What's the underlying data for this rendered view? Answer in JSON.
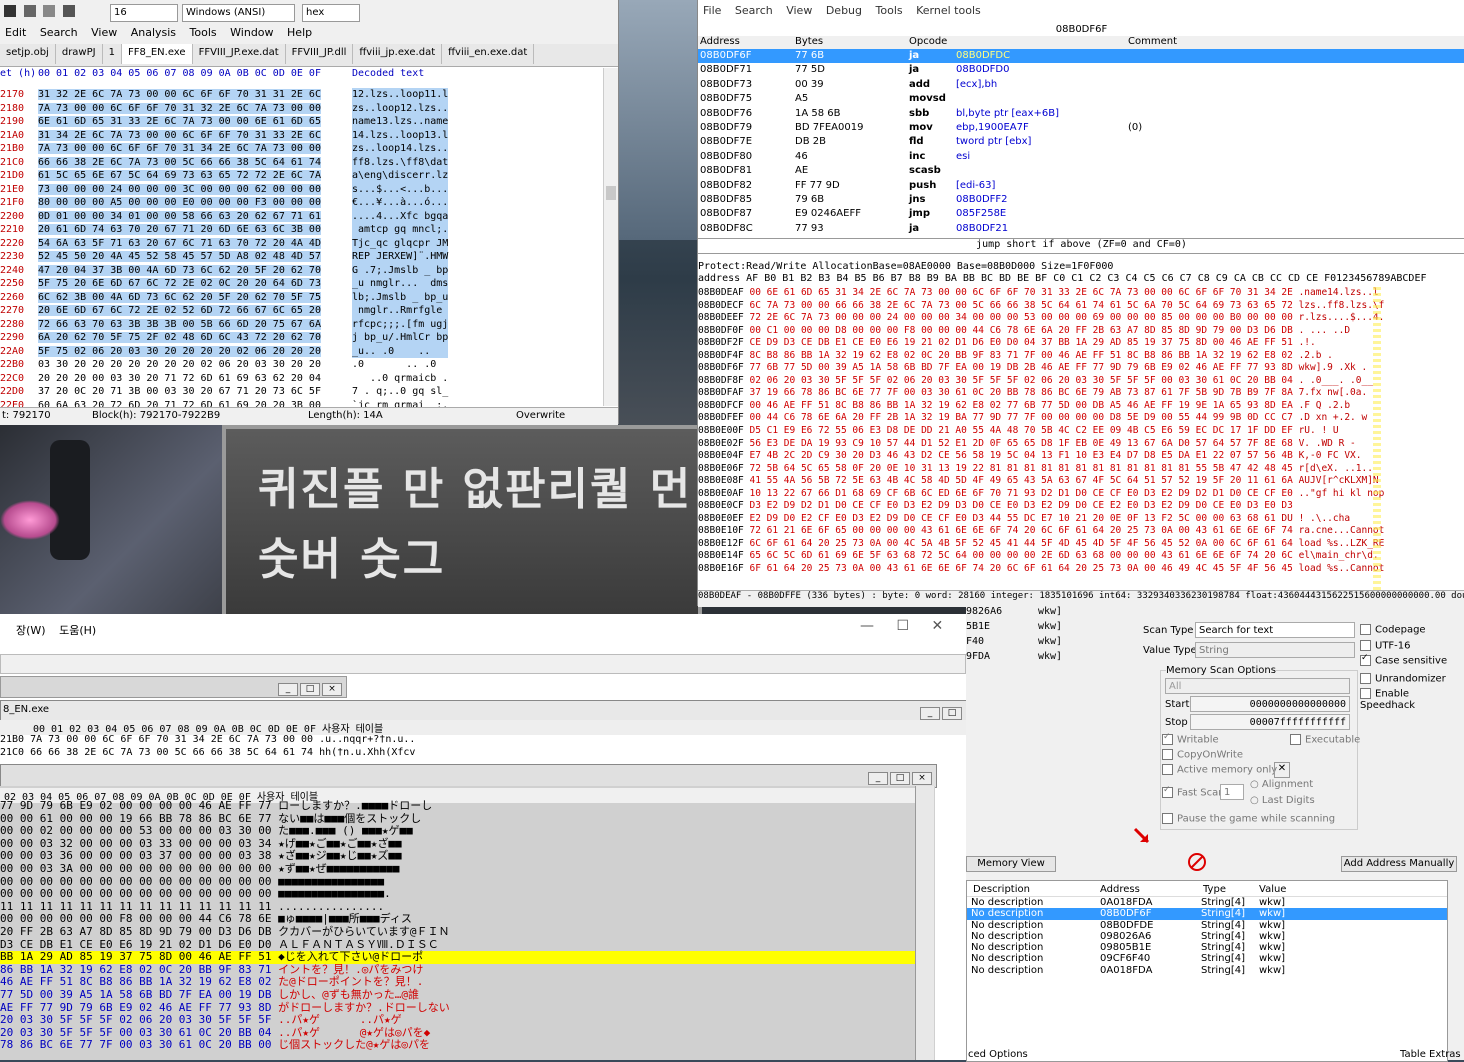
{
  "dialog": {
    "line1": "퀴진플 만 없판리퀄 먼",
    "line2": "숫버 숫그"
  },
  "hex_editor": {
    "toolbar": {
      "font_size": "16",
      "encoding": "Windows (ANSI)",
      "mode": "hex"
    },
    "menu": [
      "Edit",
      "Search",
      "View",
      "Analysis",
      "Tools",
      "Window",
      "Help"
    ],
    "tabs": [
      "setjp.obj",
      "drawPJ",
      "1",
      "FF8_EN.exe",
      "FFVIII_JP.exe.dat",
      "FFVIII_JP.dll",
      "ffviii_jp.exe.dat",
      "ffviii_en.exe.dat"
    ],
    "header_offset": "et (h)",
    "header_cols": "00 01 02 03 04 05 06 07 08 09 0A 0B 0C 0D 0E 0F",
    "header_decoded": "Decoded text",
    "rows": [
      {
        "off": "2170",
        "hex": "31 32 2E 6C 7A 73 00 00 6C 6F 6F 70 31 31 2E 6C",
        "txt": "12.lzs..loop11.l"
      },
      {
        "off": "2180",
        "hex": "7A 73 00 00 6C 6F 6F 70 31 32 2E 6C 7A 73 00 00",
        "txt": "zs..loop12.lzs.."
      },
      {
        "off": "2190",
        "hex": "6E 61 6D 65 31 33 2E 6C 7A 73 00 00 6E 61 6D 65",
        "txt": "name13.lzs..name"
      },
      {
        "off": "21A0",
        "hex": "31 34 2E 6C 7A 73 00 00 6C 6F 6F 70 31 33 2E 6C",
        "txt": "14.lzs..loop13.l"
      },
      {
        "off": "21B0",
        "hex": "7A 73 00 00 6C 6F 6F 70 31 34 2E 6C 7A 73 00 00",
        "txt": "zs..loop14.lzs.."
      },
      {
        "off": "21C0",
        "hex": "66 66 38 2E 6C 7A 73 00 5C 66 66 38 5C 64 61 74",
        "txt": "ff8.lzs.\\ff8\\dat"
      },
      {
        "off": "21D0",
        "hex": "61 5C 65 6E 67 5C 64 69 73 63 65 72 72 2E 6C 7A",
        "txt": "a\\eng\\discerr.lz"
      },
      {
        "off": "21E0",
        "hex": "73 00 00 00 24 00 00 00 3C 00 00 00 62 00 00 00",
        "txt": "s...$...<...b..."
      },
      {
        "off": "21F0",
        "hex": "80 00 00 00 A5 00 00 00 E0 00 00 00 F3 00 00 00",
        "txt": "€...¥...à...ó..."
      },
      {
        "off": "2200",
        "hex": "0D 01 00 00 34 01 00 00 58 66 63 20 62 67 71 61",
        "txt": "....4...Xfc bgqa"
      },
      {
        "off": "2210",
        "hex": "20 61 6D 74 63 70 20 67 71 20 6D 6E 63 6C 3B 00",
        "txt": " amtcp gq mncl;."
      },
      {
        "off": "2220",
        "hex": "54 6A 63 5F 71 63 20 67 6C 71 63 70 72 20 4A 4D",
        "txt": "Tjc_qc glqcpr JM"
      },
      {
        "off": "2230",
        "hex": "52 45 50 20 4A 45 52 58 45 57 5D A8 02 48 4D 57",
        "txt": "REP JERXEW]¨.HMW"
      },
      {
        "off": "2240",
        "hex": "47 20 04 37 3B 00 4A 6D 73 6C 62 20 5F 20 62 70",
        "txt": "G .7;.Jmslb _ bp"
      },
      {
        "off": "2250",
        "hex": "5F 75 20 6E 6D 67 6C 72 2E 02 0C 20 20 64 6D 73",
        "txt": "_u nmglr...  dms"
      },
      {
        "off": "2260",
        "hex": "6C 62 3B 00 4A 6D 73 6C 62 20 5F 20 62 70 5F 75",
        "txt": "lb;.Jmslb _ bp_u"
      },
      {
        "off": "2270",
        "hex": "20 6E 6D 67 6C 72 2E 02 52 6D 72 66 67 6C 65 20",
        "txt": " nmglr..Rmrfgle "
      },
      {
        "off": "2280",
        "hex": "72 66 63 70 63 3B 3B 3B 00 5B 66 6D 20 75 67 6A",
        "txt": "rfcpc;;;.[fm ugj"
      },
      {
        "off": "2290",
        "hex": "6A 20 62 70 5F 75 2F 02 48 6D 6C 43 72 20 62 70",
        "txt": "j bp_u/.HmlCr bp"
      },
      {
        "off": "22A0",
        "hex": "5F 75 02 06 20 03 30 20 20 20 20 02 06 20 20 20",
        "txt": "_u.. .0    ..   "
      },
      {
        "off": "22B0",
        "hex": "03 30 20 20 20 20 20 20 20 02 06 20 03 30 20 20",
        "txt": ".0       .. .0  "
      },
      {
        "off": "22C0",
        "hex": "20 20 20 00 03 30 20 71 72 6D 61 69 63 62 20 04",
        "txt": "   ..0 qrmaicb ."
      },
      {
        "off": "22D0",
        "hex": "37 20 0C 20 71 3B 00 03 30 20 67 71 20 73 6C 5F",
        "txt": "7 . q;..0 gq sl_"
      },
      {
        "off": "22E0",
        "hex": "60 6A 63 20 72 6D 20 71 72 6D 61 69 20 20 3B 00",
        "txt": "`jc rm qrmai  ;."
      },
      {
        "off": "22F0",
        "hex": "00 4A 6D 73 6C 62 20 5F 20 62 70 5F 75 20 6E 6D",
        "txt": ".Jmslb _ bp_u nm"
      }
    ],
    "status": {
      "offset": "t: 792170",
      "block": "Block(h): 792170-7922B9",
      "length": "Length(h): 14A",
      "mode": "Overwrite"
    }
  },
  "debugger": {
    "menu": [
      "File",
      "Search",
      "View",
      "Debug",
      "Tools",
      "Kernel tools"
    ],
    "title": "08B0DF6F",
    "columns": [
      "Address",
      "Bytes",
      "Opcode",
      "Comment"
    ],
    "rows": [
      {
        "addr": "08B0DF6F",
        "bytes": "77 6B",
        "op": "ja",
        "arg": "08B0DFDC",
        "cmt": ""
      },
      {
        "addr": "08B0DF71",
        "bytes": "77 5D",
        "op": "ja",
        "arg": "08B0DFD0",
        "cmt": ""
      },
      {
        "addr": "08B0DF73",
        "bytes": "00 39",
        "op": "add",
        "arg": "[ecx],bh",
        "cmt": ""
      },
      {
        "addr": "08B0DF75",
        "bytes": "A5",
        "op": "movsd",
        "arg": "",
        "cmt": ""
      },
      {
        "addr": "08B0DF76",
        "bytes": "1A 58 6B",
        "op": "sbb",
        "arg": "bl,byte ptr [eax+6B]",
        "cmt": ""
      },
      {
        "addr": "08B0DF79",
        "bytes": "BD 7FEA0019",
        "op": "mov",
        "arg": "ebp,1900EA7F",
        "cmt": "(0)"
      },
      {
        "addr": "08B0DF7E",
        "bytes": "DB 2B",
        "op": "fld",
        "arg": "tword ptr [ebx]",
        "cmt": ""
      },
      {
        "addr": "08B0DF80",
        "bytes": "46",
        "op": "inc",
        "arg": "esi",
        "cmt": ""
      },
      {
        "addr": "08B0DF81",
        "bytes": "AE",
        "op": "scasb",
        "arg": "",
        "cmt": ""
      },
      {
        "addr": "08B0DF82",
        "bytes": "FF 77 9D",
        "op": "push",
        "arg": "[edi-63]",
        "cmt": ""
      },
      {
        "addr": "08B0DF85",
        "bytes": "79 6B",
        "op": "jns",
        "arg": "08B0DFF2",
        "cmt": ""
      },
      {
        "addr": "08B0DF87",
        "bytes": "E9 0246AEFF",
        "op": "jmp",
        "arg": "085F258E",
        "cmt": ""
      },
      {
        "addr": "08B0DF8C",
        "bytes": "77 93",
        "op": "ja",
        "arg": "08B0DF21",
        "cmt": ""
      }
    ],
    "jump_status": "jump short if above (ZF=0 and CF=0)",
    "mem_protect": "Protect:Read/Write  AllocationBase=08AE0000 Base=08B0D000 Size=1F0F000",
    "mem_header": "address  AF B0 B1 B2 B3 B4 B5 B6 B7 B8 B9 BA BB BC BD BE BF C0 C1 C2 C3 C4 C5 C6 C7 C8 C9 CA CB CC CD CE F0123456789ABCDEF",
    "mem_rows": [
      {
        "a": "08B0DEAF",
        "b": "00 6E 61 6D 65 31 34 2E 6C 7A 73 00 00 6C 6F 6F 70 31 33 2E 6C 7A 73 00 00 6C 6F 6F 70 31 34 2E",
        "t": ".name14.lzs..l"
      },
      {
        "a": "08B0DECF",
        "b": "6C 7A 73 00 00 66 66 38 2E 6C 7A 73 00 5C 66 66 38 5C 64 61 74 61 5C 6A 70 5C 64 69 73 63 65 72",
        "t": "lzs..ff8.lzs.\\f"
      },
      {
        "a": "08B0DEEF",
        "b": "72 2E 6C 7A 73 00 00 00 24 00 00 00 34 00 00 00 53 00 00 00 69 00 00 00 85 00 00 00 B0 00 00 00",
        "t": "r.lzs....$...4."
      },
      {
        "a": "08B0DF0F",
        "b": "00 C1 00 00 00 D8 00 00 00 F8 00 00 00 44 C6 78 6E 6A 20 FF 2B 63 A7 8D 85 8D 9D 79 00 D3 D6 DB",
        "t": ".  ...  ..D"
      },
      {
        "a": "08B0DF2F",
        "b": "CE D9 D3 CE DB E1 CE E0 E6 19 21 02 D1 D6 E0 D0 04 37 BB 1A 29 AD 85 19 37 75 8D 00 46 AE FF 51",
        "t": ".!."
      },
      {
        "a": "08B0DF4F",
        "b": "8C B8 86 BB 1A 32 19 62 E8 02 0C 20 BB 9F 83 71 7F 00 46 AE FF 51 8C B8 86 BB 1A 32 19 62 E8 02",
        "t": ".2.b ."
      },
      {
        "a": "08B0DF6F",
        "b": "77 6B 77 5D 00 39 A5 1A 58 6B BD 7F EA 00 19 DB 2B 46 AE FF 77 9D 79 6B E9 02 46 AE FF 77 93 8D",
        "t": "wkw].9 .Xk ."
      },
      {
        "a": "08B0DF8F",
        "b": "02 06 20 03 30 5F 5F 5F 02 06 20 03 30 5F 5F 5F 02 06 20 03 30 5F 5F 5F 00 03 30 61 0C 20 BB 04",
        "t": ". .0___. .0__"
      },
      {
        "a": "08B0DFAF",
        "b": "37 19 66 78 86 BC 6E 77 7F 00 03 30 61 0C 20 BB 78 86 BC 6E 79 AB 73 87 61 7F 5B 9D 7B B9 7F 8A",
        "t": "7.fx nw[.0a."
      },
      {
        "a": "08B0DFCF",
        "b": "00 46 AE FF 51 8C B8 86 BB 1A 32 19 62 E8 02 77 6B 77 5D 00 DB A5 46 AE FF 19 9E 1A 65 93 8D EA",
        "t": ".F Q   .2.b"
      },
      {
        "a": "08B0DFEF",
        "b": "00 44 C6 78 6E 6A 20 FF 2B 1A 32 19 BA 77 9D 77 7F 00 00 00 00 D8 5E D9 00 55 44 99 9B 0D CC C7",
        "t": ".D xn  +.2. w"
      },
      {
        "a": "08B0E00F",
        "b": "D5 C1 E9 E6 72 55 06 E3 D8 DE DD 21 A0 55 4A 48 70 5B 4C C2 EE 09 4B C5 E6 59 EC DC 17 1F DD EF",
        "t": "rU.  ! U"
      },
      {
        "a": "08B0E02F",
        "b": "56 E3 DE DA 19 93 C9 10 57 44 D1 52 E1 2D 0F 65 65 D8 1F EB 0E 49 13 67 6A D0 57 64 57 7F 8E 68",
        "t": "V.   .WD R -"
      },
      {
        "a": "08B0E04F",
        "b": "E7 4B 2C 2D C9 30 20 D3 46 43 D2 CE 56 58 19 5C 04 13 F1 10 E3 E4 D7 D8 E5 DA E1 22 07 57 56 4B",
        "t": "K,-0 FC VX."
      },
      {
        "a": "08B0E06F",
        "b": "72 5B 64 5C 65 58 0F 20 0E 10 31 13 19 22 81 81 81 81 81 81 81 81 81 81 81 81 55 5B 47 42 48 45",
        "t": "r[d\\eX. ..1.."
      },
      {
        "a": "08B0E08F",
        "b": "41 55 4A 56 5B 72 5E 63 4B 4C 58 4D 5D 4F 49 65 43 5A 63 67 4F 5C 64 51 57 52 19 5F 20 11 61 6A",
        "t": "AUJV[r^cKLXM]N"
      },
      {
        "a": "08B0E0AF",
        "b": "10 13 22 67 66 D1 68 69 CF 6B 6C ED 6E 6F 70 71 93 D2 D1 D0 CE CF E0 D3 E2 D9 D2 D1 D0 CE CF E0",
        "t": "..\"gf hi kl nop"
      },
      {
        "a": "08B0E0CF",
        "b": "D3 E2 D9 D2 D1 D0 CE CF E0 D3 E2 D9 D3 D0 CE E0 D3 E2 D9 D0 CE E2 E0 D3 E2 D9 D0 CE E0 D3 E0 D3",
        "t": ""
      },
      {
        "a": "08B0E0EF",
        "b": "E2 D9 D0 E2 CF E0 D3 E2 D9 D0 CE CF E0 D3 44 55 DC E7 10 21 20 0E 0F 13 F2 5C 00 00 63 68 61",
        "t": "DU  ! .\\..cha"
      },
      {
        "a": "08B0E10F",
        "b": "72 61 21 6E 6F 65 00 00 00 00 43 61 6E 6E 6F 74 20 6C 6F 61 64 20 25 73 0A 00 43 61 6E 6E 6F 74",
        "t": "ra.cne...Cannot"
      },
      {
        "a": "08B0E12F",
        "b": "6C 6F 61 64 20 25 73 0A 00 4C 5A 4B 5F 52 45 41 44 5F 4D 45 4D 5F 4F 56 45 52 0A 00 6C 6F 61 64",
        "t": "load %s..LZK_RE"
      },
      {
        "a": "08B0E14F",
        "b": "65 6C 5C 6D 61 69 6E 5F 63 68 72 5C 64 00 00 00 00 2E 6D 63 68 00 00 00 43 61 6E 6E 6F 74 20 6C",
        "t": "el\\main_chr\\d."
      },
      {
        "a": "08B0E16F",
        "b": "6F 61 64 20 25 73 0A 00 43 61 6E 6E 6F 74 20 6C 6F 61 64 20 25 73 0A 00 46 49 4C 45 5F 4F 56 45",
        "t": "load %s..Cannot"
      }
    ],
    "mem_status": "08B0DEAF - 08B0DFFE (336 bytes) : byte: 0 word: 28160 integer: 1835101696 int64: 3329340336230198784 float:4360444315622515600000000000.00 double: 0.00"
  },
  "jp_editor": {
    "menu": [
      "장(W)",
      "도움(H)"
    ],
    "sub1_title": "",
    "sub2_title": "8_EN.exe",
    "hdr2": "00 01 02 03 04 05 06 07 08 09 0A 0B 0C 0D 0E 0F 사용자 테이블",
    "rows2": [
      "21B0 7A 73 00 00 6C 6F 6F 70 31 34 2E 6C 7A 73 00 00 .u..nqqr+?†n.u..",
      "21C0 66 66 38 2E 6C 7A 73 00 5C 66 66 38 5C 64 61 74 hh(†n.u.Xhh(Xfcv"
    ],
    "hdr3": "02 03 04 05 06 07 08 09 0A 0B 0C 0D 0E 0F 사용자 테이블",
    "rows3": [
      {
        "h": "77 9D 79 6B E9 02 00 00 00 00 46 AE FF 77",
        "t": "ローしますか？.■■■■ドローし",
        "c": ""
      },
      {
        "h": "00 00 61 00 00 00 19 66 BB 78 86 BC 6E 77",
        "t": "ない■■は■■■個をストックし",
        "c": ""
      },
      {
        "h": "00 00 02 00 00 00 00 53 00 00 00 03 30 00",
        "t": "た■■■.■■■ () ■■■★ゲ■■",
        "c": ""
      },
      {
        "h": "00 00 03 32 00 00 00 03 33 00 00 00 03 34",
        "t": "★げ■■★ご■■★ご■■★ざ■■",
        "c": ""
      },
      {
        "h": "00 00 03 36 00 00 00 03 37 00 00 00 03 38",
        "t": "★ざ■■★ジ■■★じ■■★ズ■■",
        "c": ""
      },
      {
        "h": "00 00 03 3A 00 00 00 00 00 00 00 00 00 00",
        "t": "★ず■■★ぜ■■■■■■■■■■■",
        "c": ""
      },
      {
        "h": "00 00 00 00 00 00 00 00 00 00 00 00 00 00",
        "t": "■■■■■■■■■■■■■■■■",
        "c": ""
      },
      {
        "h": "00 00 00 00 00 00 00 00 00 00 00 00 00 00",
        "t": "■■■■■■■■■■■■■■■■.",
        "c": ""
      },
      {
        "h": "11 11 11 11 11 11 11 11 11 11 11 11 11 11",
        "t": "................",
        "c": ""
      },
      {
        "h": "00 00 00 00 00 00 F8 00 00 00 44 C6 78 6E",
        "t": "■ゅ■■■■|■■■所■■■ディス",
        "c": ""
      },
      {
        "h": "20 FF 2B 63 A7 8D 85 8D 9D 79 00 D3 D6 DB",
        "t": "クカバーがひらいています@ＦＩＮ",
        "c": ""
      },
      {
        "h": "D3 CE DB E1 CE E0 E6 19 21 02 D1 D6 E0 D0",
        "t": "ＡＬＦＡＮＴＡＳＹⅧ.ＤＩＳＣ",
        "c": ""
      },
      {
        "h": "BB 1A 29 AD 85 19 37 75 8D 00 46 AE FF 51",
        "t": "◆じを入れて下さい@ドローポ",
        "c": "y"
      },
      {
        "h": "86 BB 1A 32 19 62 E8 02 0C 20 BB 9F 83 71",
        "t": "イントを？見！.◎パをみつけ",
        "c": "red"
      },
      {
        "h": "46 AE FF 51 8C B8 86 BB 1A 32 19 62 E8 02",
        "t": "た@ドローポイントを？見！.",
        "c": "red"
      },
      {
        "h": "77 5D 00 39 A5 1A 58 6B BD 7F EA 00 19 DB",
        "t": "しかし、@ずも無かった…@誰",
        "c": "red"
      },
      {
        "h": "AE FF 77 9D 79 6B E9 02 46 AE FF 77 93 8D",
        "t": "がドローしますか？.ドローしない",
        "c": "red"
      },
      {
        "h": "20 03 30 5F 5F 5F 02 06 20 03 30 5F 5F 5F",
        "t": "..パ★ゲ      ..パ★ゲ",
        "c": "red"
      },
      {
        "h": "20 03 30 5F 5F 5F 00 03 30 61 0C 20 BB 04",
        "t": "..パ★ゲ      @★ゲは◎パを◆",
        "c": "red"
      },
      {
        "h": "78 86 BC 6E 77 7F 00 03 30 61 0C 20 BB 00",
        "t": "じ個ストックした@★ゲは◎パを",
        "c": "red"
      }
    ]
  },
  "cheat_engine": {
    "found_list": [
      {
        "addr": "9826A6",
        "val": "wkw]"
      },
      {
        "addr": "5B1E",
        "val": "wkw]"
      },
      {
        "addr": "F40",
        "val": "wkw]"
      },
      {
        "addr": "9FDA",
        "val": "wkw]"
      }
    ],
    "scan_type_label": "Scan Type",
    "scan_type_value": "Search for text",
    "value_type_label": "Value Type",
    "value_type_value": "String",
    "memory_scan_options": "Memory Scan Options",
    "region": "All",
    "start_label": "Start",
    "start_value": "0000000000000000",
    "stop_label": "Stop",
    "stop_value": "00007fffffffffff",
    "writable": "Writable",
    "executable": "Executable",
    "copy_on_write": "CopyOnWrite",
    "active_memory_only": "Active memory only",
    "fast_scan": "Fast Scan",
    "fast_scan_value": "1",
    "alignment": "Alignment",
    "last_digits": "Last Digits",
    "pause_game": "Pause the game while scanning",
    "codepage": "Codepage",
    "utf16": "UTF-16",
    "case_sensitive": "Case sensitive",
    "unrandomizer": "Unrandomizer",
    "enable_speedhack": "Enable Speedhack",
    "memory_view_button": "Memory View",
    "add_address_button": "Add Address Manually",
    "table_headers": [
      "Description",
      "Address",
      "Type",
      "Value"
    ],
    "table_rows": [
      {
        "desc": "No description",
        "addr": "0A018FDA",
        "type": "String[4]",
        "val": "wkw]"
      },
      {
        "desc": "No description",
        "addr": "08B0DF6F",
        "type": "String[4]",
        "val": "wkw]"
      },
      {
        "desc": "No description",
        "addr": "08B0DFDE",
        "type": "String[4]",
        "val": "wkw]"
      },
      {
        "desc": "No description",
        "addr": "098026A6",
        "type": "String[4]",
        "val": "wkw]"
      },
      {
        "desc": "No description",
        "addr": "09805B1E",
        "type": "String[4]",
        "val": "wkw]"
      },
      {
        "desc": "No description",
        "addr": "09CF6F40",
        "type": "String[4]",
        "val": "wkw]"
      },
      {
        "desc": "No description",
        "addr": "0A018FDA",
        "type": "String[4]",
        "val": "wkw]"
      }
    ],
    "advanced_options": "ced Options",
    "table_extras": "Table Extras"
  }
}
